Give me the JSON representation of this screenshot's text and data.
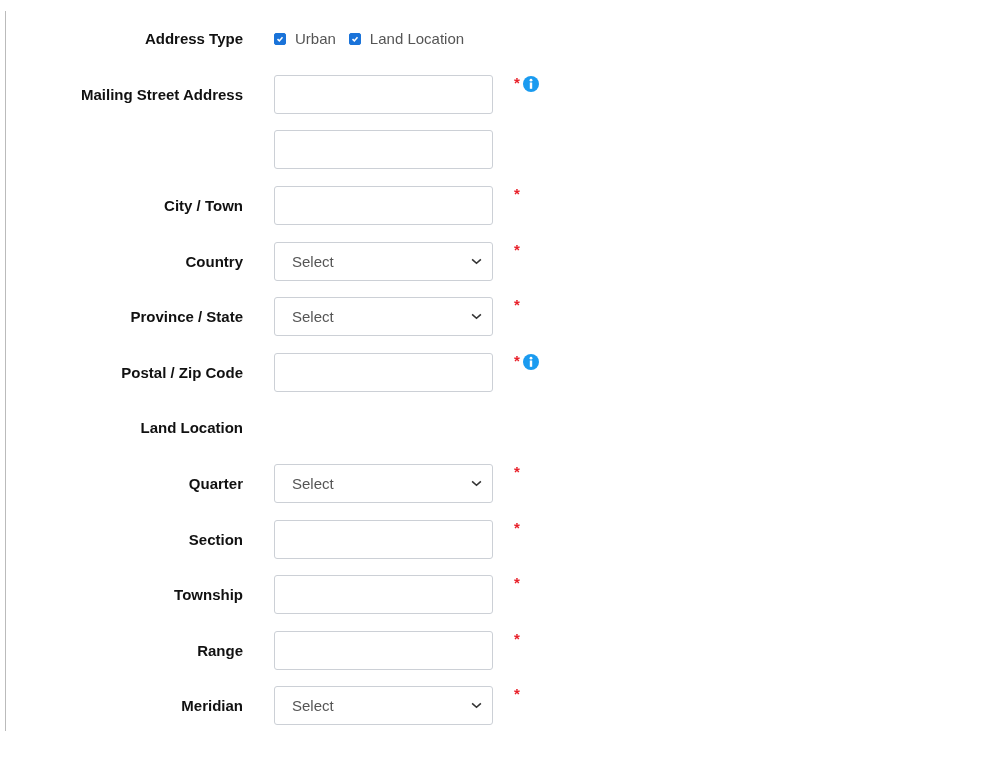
{
  "rows": [
    {
      "kind": "checkboxes",
      "label": "Address Type",
      "options": [
        {
          "label": "Urban",
          "checked": true
        },
        {
          "label": "Land Location",
          "checked": true
        }
      ]
    },
    {
      "kind": "text",
      "label": "Mailing Street Address",
      "required_mark": "*",
      "info": true
    },
    {
      "kind": "text"
    },
    {
      "kind": "text",
      "label": "City / Town",
      "required_mark": "*",
      "info": false
    },
    {
      "kind": "select",
      "label": "Country",
      "placeholder": "Select",
      "required_mark": "*",
      "info": false
    },
    {
      "kind": "select",
      "label": "Province / State",
      "placeholder": "Select",
      "required_mark": "*",
      "info": false
    },
    {
      "kind": "text",
      "label": "Postal / Zip Code",
      "required_mark": "*",
      "info": true
    },
    {
      "kind": "heading",
      "label": "Land Location"
    },
    {
      "kind": "select",
      "label": "Quarter",
      "placeholder": "Select",
      "required_mark": "*",
      "info": false
    },
    {
      "kind": "text",
      "label": "Section",
      "required_mark": "*",
      "info": false
    },
    {
      "kind": "text",
      "label": "Township",
      "required_mark": "*",
      "info": false
    },
    {
      "kind": "text",
      "label": "Range",
      "required_mark": "*",
      "info": false
    },
    {
      "kind": "select",
      "label": "Meridian",
      "placeholder": "Select",
      "required_mark": "*",
      "info": false
    }
  ]
}
